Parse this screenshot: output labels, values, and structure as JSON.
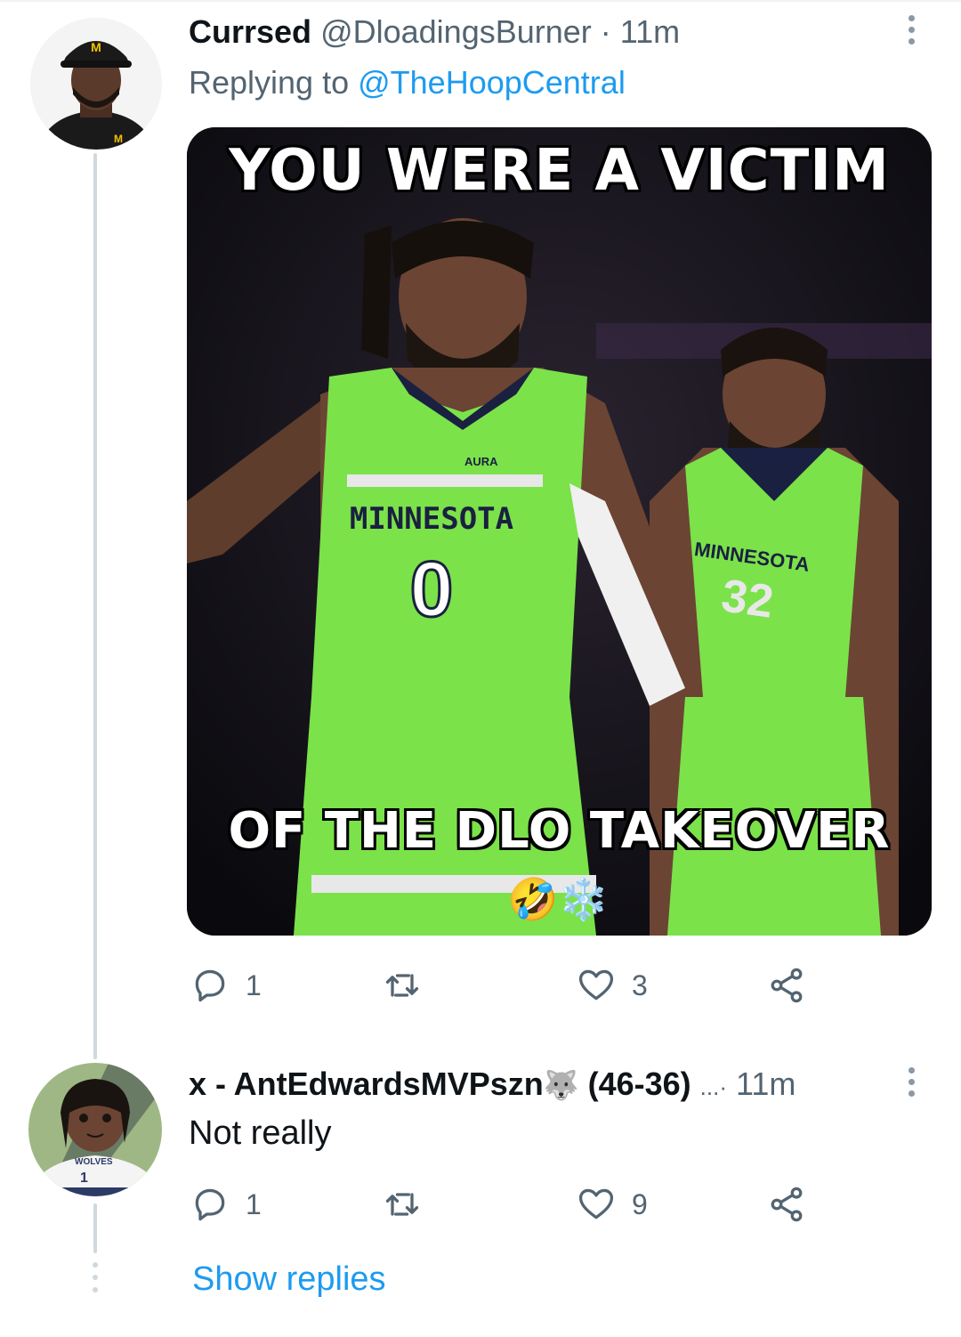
{
  "tweet1": {
    "name": "Currsed",
    "handle": "@DloadingsBurner",
    "separator": "·",
    "time": "11m",
    "replying_prefix": "Replying to",
    "replying_to": "@TheHoopCentral",
    "media": {
      "top_text": "YOU WERE A VICTIM",
      "bottom_text": "OF THE DLO TAKEOVER",
      "jersey_left_team": "MINNESOTA",
      "jersey_left_number": "0",
      "jersey_left_sponsor": "AURA",
      "jersey_right_team": "MINNESOTA",
      "jersey_right_number": "32",
      "emoji": "🤣❄️"
    },
    "actions": {
      "replies": "1",
      "retweets": "",
      "likes": "3"
    }
  },
  "tweet2": {
    "name": "x - AntEdwardsMVPszn",
    "name_suffix": "(46-36)",
    "ellipsis": "...·",
    "time": "11m",
    "text": "Not really",
    "avatar_jersey": "WOLVES",
    "avatar_number": "1",
    "actions": {
      "replies": "1",
      "retweets": "",
      "likes": "9"
    }
  },
  "show_replies": "Show replies",
  "colors": {
    "accent": "#1d9bf0",
    "secondary_text": "#536471",
    "jersey_green": "#7be24a"
  }
}
